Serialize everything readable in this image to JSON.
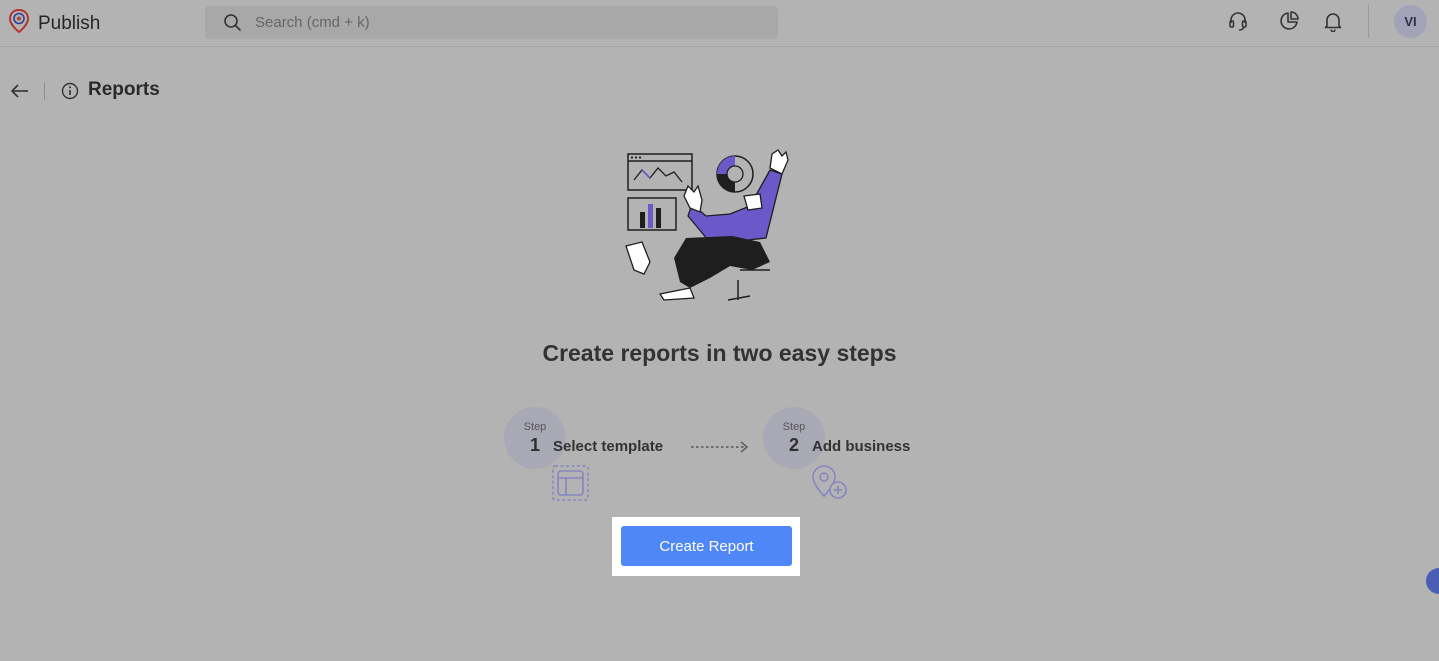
{
  "app": {
    "name": "Publish"
  },
  "search": {
    "placeholder": "Search (cmd + k)"
  },
  "user": {
    "initials": "VI"
  },
  "page": {
    "title": "Reports"
  },
  "empty_state": {
    "headline": "Create reports in two easy steps",
    "steps": [
      {
        "word": "Step",
        "number": "1",
        "label": "Select template",
        "icon": "template-icon"
      },
      {
        "word": "Step",
        "number": "2",
        "label": "Add business",
        "icon": "location-add-icon"
      }
    ],
    "cta_label": "Create Report"
  },
  "colors": {
    "accent": "#4f87f7",
    "illustration_purple": "#6b58c9",
    "avatar_bg": "#a2a3b6"
  }
}
